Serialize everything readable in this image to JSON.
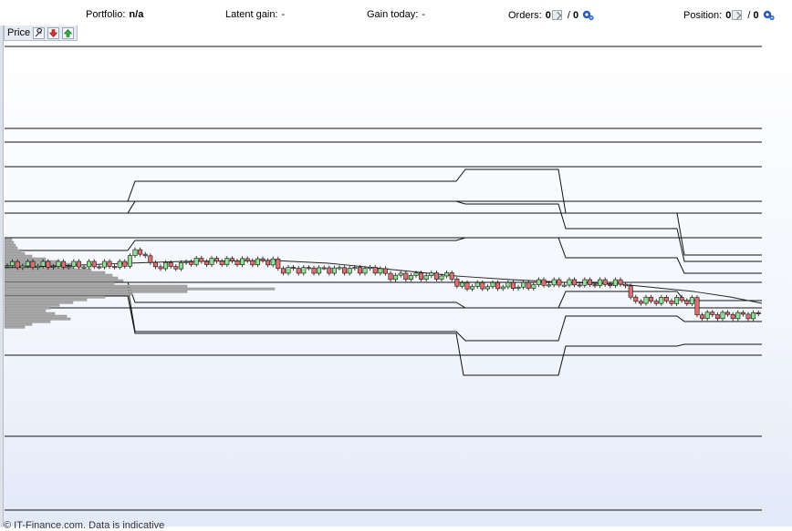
{
  "toolbar": {
    "portfolio_label": "Portfolio:",
    "portfolio_value": "n/a",
    "latent_gain_label": "Latent gain:",
    "latent_gain_value": "-",
    "gain_today_label": "Gain today:",
    "gain_today_value": "-",
    "orders_label": "Orders:",
    "orders_open": "0",
    "orders_separator": "/",
    "orders_total": "0",
    "position_label": "Position:",
    "position_open": "0",
    "position_separator": "/",
    "position_total": "0"
  },
  "chart_panel": {
    "title": "Price",
    "icons": [
      "wrench-icon",
      "arrow-down-icon",
      "arrow-up-icon"
    ]
  },
  "footer": {
    "note": "© IT-Finance.com. Data is indicative"
  },
  "colors": {
    "up_candle": "#90e090",
    "down_candle": "#e07070",
    "background_top": "#ffffff",
    "background_bottom": "#e2e9f8",
    "volume_profile": "#a8a8a8"
  },
  "chart_data": {
    "type": "candlestick",
    "y_axis": "hidden",
    "x_axis": "hidden",
    "overlays": [
      "moving-average",
      "support-resistance-bands",
      "volume-profile"
    ]
  }
}
